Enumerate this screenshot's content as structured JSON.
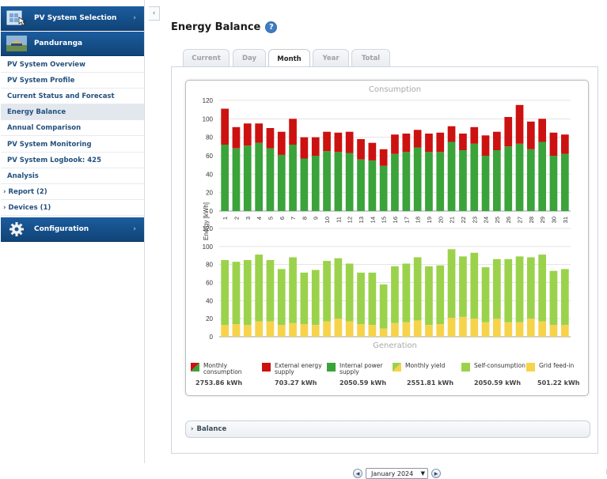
{
  "sidebar": {
    "system_selection": "PV System Selection",
    "system_name": "Panduranga",
    "items": [
      {
        "label": "PV System Overview"
      },
      {
        "label": "PV System Profile"
      },
      {
        "label": "Current Status and Forecast"
      },
      {
        "label": "Energy Balance"
      },
      {
        "label": "Annual Comparison"
      },
      {
        "label": "PV System Monitoring"
      },
      {
        "label": "PV System Logbook: 425"
      },
      {
        "label": "Analysis"
      },
      {
        "label": "Report (2)"
      },
      {
        "label": "Devices (1)"
      }
    ],
    "configuration": "Configuration"
  },
  "page": {
    "title": "Energy Balance",
    "help_icon": "question-mark",
    "tabs": [
      {
        "label": "Current"
      },
      {
        "label": "Day"
      },
      {
        "label": "Month"
      },
      {
        "label": "Year"
      },
      {
        "label": "Total"
      }
    ],
    "active_tab": "Month",
    "month_select": "January 2024",
    "balance_label": "Balance"
  },
  "legend": [
    {
      "label": "Monthly consumption",
      "value": "2753.86 kWh",
      "color": "#3aa33a"
    },
    {
      "label": "External energy supply",
      "value": "703.27 kWh",
      "color": "#cc1111"
    },
    {
      "label": "Internal power supply",
      "value": "2050.59 kWh",
      "color": "#3aa33a"
    },
    {
      "label": "Monthly yield",
      "value": "2551.81 kWh",
      "color": "#9bd24b"
    },
    {
      "label": "Self-consumption",
      "value": "2050.59 kWh",
      "color": "#9bd24b"
    },
    {
      "label": "Grid feed-in",
      "value": "501.22 kWh",
      "color": "#f7d34a"
    }
  ],
  "chart_data": [
    {
      "type": "bar",
      "title": "Consumption",
      "ylabel": "Energy [kWh]",
      "ylim": [
        0,
        120
      ],
      "categories": [
        "1",
        "2",
        "3",
        "4",
        "5",
        "6",
        "7",
        "8",
        "9",
        "10",
        "11",
        "12",
        "13",
        "14",
        "15",
        "16",
        "17",
        "18",
        "19",
        "20",
        "21",
        "22",
        "23",
        "24",
        "25",
        "26",
        "27",
        "28",
        "29",
        "30",
        "31"
      ],
      "series": [
        {
          "name": "Internal power supply",
          "color": "#3aa33a",
          "values": [
            72,
            68,
            71,
            74,
            68,
            61,
            72,
            57,
            60,
            65,
            64,
            63,
            56,
            55,
            49,
            62,
            64,
            69,
            64,
            64,
            75,
            66,
            73,
            60,
            66,
            70,
            73,
            67,
            75,
            60,
            62
          ]
        },
        {
          "name": "External energy supply",
          "color": "#cc1111",
          "values": [
            39,
            23,
            24,
            21,
            22,
            25,
            28,
            23,
            20,
            21,
            21,
            23,
            22,
            19,
            18,
            21,
            20,
            19,
            20,
            21,
            17,
            18,
            18,
            22,
            20,
            32,
            42,
            30,
            25,
            25,
            21
          ]
        }
      ]
    },
    {
      "type": "bar",
      "title": "Generation",
      "ylabel": "Energy [kWh]",
      "ylim": [
        0,
        120
      ],
      "categories": [
        "1",
        "2",
        "3",
        "4",
        "5",
        "6",
        "7",
        "8",
        "9",
        "10",
        "11",
        "12",
        "13",
        "14",
        "15",
        "16",
        "17",
        "18",
        "19",
        "20",
        "21",
        "22",
        "23",
        "24",
        "25",
        "26",
        "27",
        "28",
        "29",
        "30",
        "31"
      ],
      "series": [
        {
          "name": "Grid feed-in",
          "color": "#f7d34a",
          "values": [
            13,
            14,
            13,
            17,
            17,
            13,
            15,
            14,
            13,
            17,
            20,
            17,
            14,
            13,
            9,
            15,
            16,
            18,
            13,
            14,
            21,
            22,
            20,
            16,
            20,
            16,
            16,
            20,
            17,
            13,
            13
          ]
        },
        {
          "name": "Self-consumption",
          "color": "#9bd24b",
          "values": [
            72,
            69,
            72,
            74,
            68,
            62,
            73,
            57,
            61,
            67,
            67,
            64,
            57,
            58,
            49,
            63,
            65,
            70,
            65,
            65,
            76,
            67,
            73,
            61,
            66,
            70,
            73,
            68,
            74,
            60,
            62
          ]
        }
      ]
    }
  ]
}
